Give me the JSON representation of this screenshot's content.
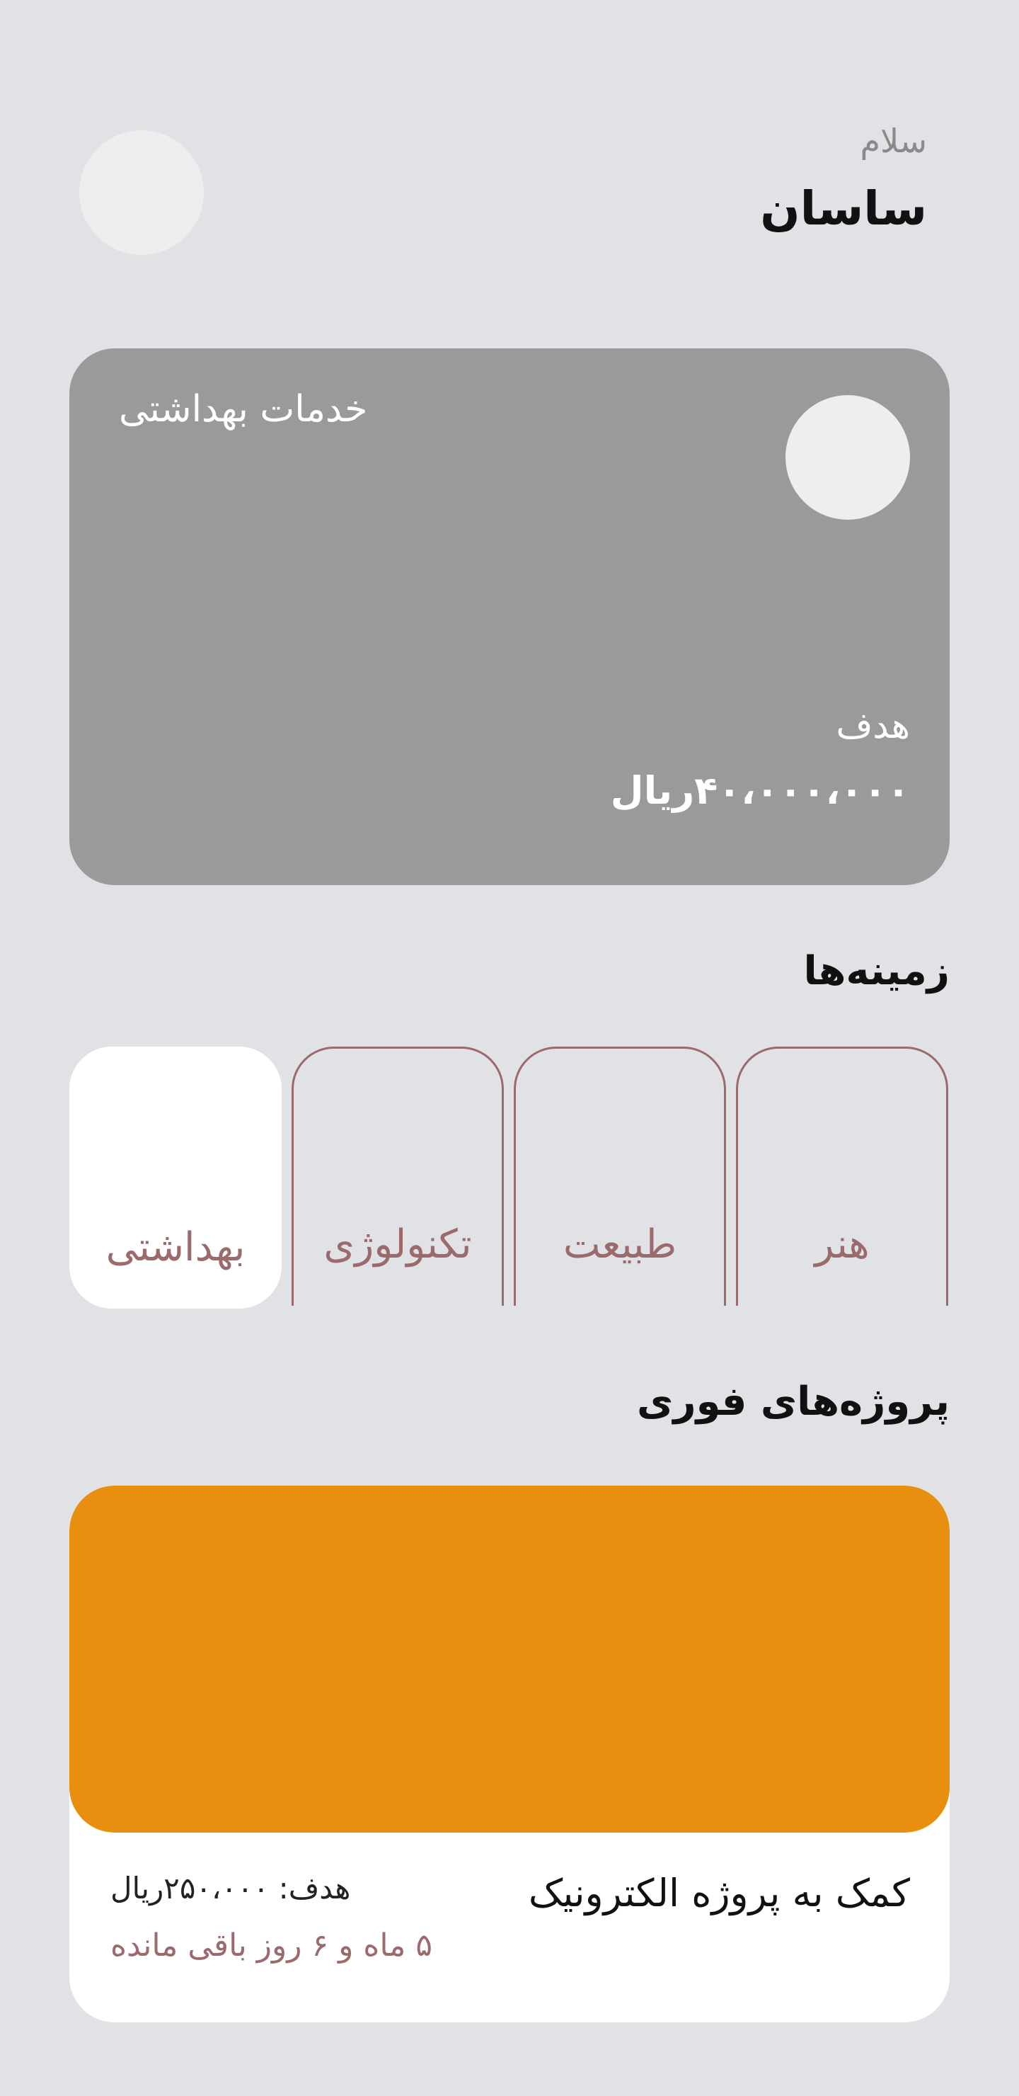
{
  "header": {
    "greeting": "سلام",
    "username": "ساسان"
  },
  "featured": {
    "title": "خدمات بهداشتی",
    "goal_label": "هدف",
    "goal_value": "۴۰،۰۰۰،۰۰۰ریال"
  },
  "categories": {
    "title": "زمینه‌ها",
    "items": [
      {
        "label": "هنر",
        "active": false
      },
      {
        "label": "طبیعت",
        "active": false
      },
      {
        "label": "تکنولوژی",
        "active": false
      },
      {
        "label": "بهداشتی",
        "active": true
      }
    ]
  },
  "urgent": {
    "title": "پروژه‌های فوری",
    "project": {
      "name": "کمک به پروژه الکترونیک",
      "goal": "هدف: ۲۵۰،۰۰۰ریال",
      "remaining": "۵ ماه و ۶ روز باقی مانده"
    }
  },
  "colors": {
    "background": "#E1E2E6",
    "featured_card": "#9A9A9A",
    "accent_orange": "#E98F10",
    "muted_rose": "#9B6A6C",
    "avatar_placeholder": "#EEEEEE"
  }
}
